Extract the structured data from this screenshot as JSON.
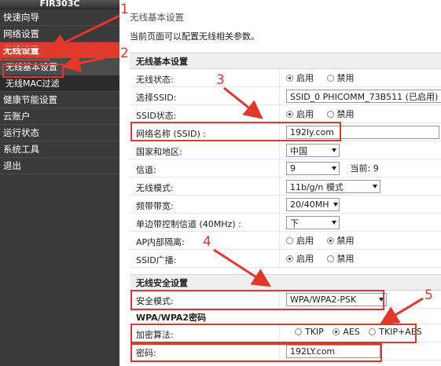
{
  "sidebar": {
    "brand": "FIR303C",
    "items": [
      {
        "label": "快速向导"
      },
      {
        "label": "网络设置"
      },
      {
        "label": "无线设置"
      },
      {
        "label": "无线基本设置"
      },
      {
        "label": "无线MAC过滤"
      },
      {
        "label": "健康节能设置"
      },
      {
        "label": "云账户"
      },
      {
        "label": "运行状态"
      },
      {
        "label": "系统工具"
      },
      {
        "label": "退出"
      }
    ]
  },
  "main": {
    "title": "无线基本设置",
    "description": "当前页面可以配置无线相关参数。",
    "basic_section_title": "无线基本设置",
    "wireless_status": {
      "label": "无线状态:",
      "on": "启用",
      "off": "禁用"
    },
    "ssid_select": {
      "label": "选择SSID:",
      "value": "SSID_0 PHICOMM_73B511 (已启用)"
    },
    "ssid_status": {
      "label": "SSID状态:",
      "on": "启用",
      "off": "禁用"
    },
    "network_name": {
      "label": "网络名称 (SSID) :",
      "value": "192ly.com"
    },
    "region": {
      "label": "国家和地区:",
      "value": "中国"
    },
    "channel": {
      "label": "信道:",
      "value": "9",
      "current_label": "当前:",
      "current_value": "9"
    },
    "wireless_mode": {
      "label": "无线模式:",
      "value": "11b/g/n 模式"
    },
    "bandwidth": {
      "label": "频带带宽:",
      "value": "20/40MH"
    },
    "sideband": {
      "label": "单边带控制信道 (40MHz) :",
      "value": "下"
    },
    "ap_isolation": {
      "label": "AP内部隔离:",
      "on": "启用",
      "off": "禁用"
    },
    "ssid_broadcast": {
      "label": "SSID广播:",
      "on": "启用",
      "off": "禁用"
    },
    "security_section_title": "无线安全设置",
    "security_mode": {
      "label": "安全模式:",
      "value": "WPA/WPA2-PSK"
    },
    "wpa_heading": "WPA/WPA2密码",
    "encryption": {
      "label": "加密算法:",
      "options": [
        "TKIP",
        "AES",
        "TKIP+AES"
      ]
    },
    "password": {
      "label": "密码:",
      "value": "192LY.com"
    }
  },
  "annotations": {
    "n1": "1",
    "n2": "2",
    "n3": "3",
    "n4": "4",
    "n5": "5",
    "color": "#e0382b"
  }
}
